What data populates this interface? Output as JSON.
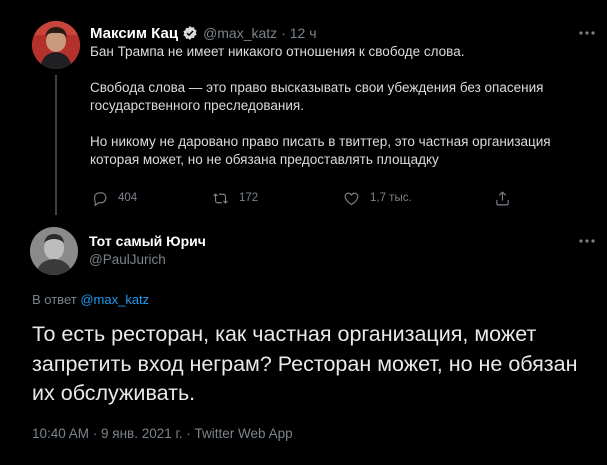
{
  "tweet": {
    "author_name": "Максим Кац",
    "author_handle": "@max_katz",
    "time": "· 12 ч",
    "text": "Бан Трампа не имеет никакого отношения к свободе слова.\n\nСвобода слова — это право высказывать свои убеждения без опасения государственного преследования.\n\nНо никому не даровано право писать в твиттер, это частная организация которая может, но не обязана предоставлять площадку",
    "replies": "404",
    "retweets": "172",
    "likes": "1,7 тыс.",
    "icons": [
      "verified-badge-icon",
      "more-icon",
      "reply-icon",
      "retweet-icon",
      "like-icon",
      "share-icon"
    ]
  },
  "reply": {
    "author_name": "Тот самый Юрич",
    "author_handle": "@PaulJurich",
    "reply_to_prefix": "В ответ",
    "reply_to_handle": "@max_katz",
    "text": "То есть ресторан, как частная организация, может запретить вход неграм? Ресторан может, но не обязан их обслуживать.",
    "meta": "10:40 AM · 9 янв. 2021 г. · Twitter Web App"
  },
  "colors": {
    "background": "#000000",
    "accent": "#1d9bf0",
    "secondary_text": "#7b838b",
    "verified": "#d9d9d9"
  }
}
